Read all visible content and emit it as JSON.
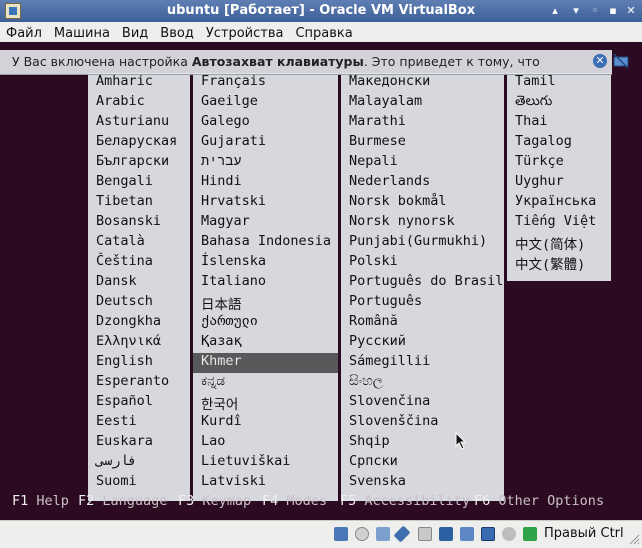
{
  "window": {
    "title": "ubuntu [Работает] - Oracle VM VirtualBox",
    "buttons": [
      "▴",
      "▾",
      "◦",
      "▪",
      "✕"
    ]
  },
  "menu": [
    "Файл",
    "Машина",
    "Вид",
    "Ввод",
    "Устройства",
    "Справка"
  ],
  "notification": {
    "prefix": "У Вас включена настройка ",
    "bold": "Автозахват клавиатуры",
    "suffix": ". Это приведет к тому, что"
  },
  "languages": {
    "col1": [
      "Amharic",
      "Arabic",
      "Asturianu",
      "Беларуская",
      "Български",
      "Bengali",
      "Tibetan",
      "Bosanski",
      "Català",
      "Čeština",
      "Dansk",
      "Deutsch",
      "Dzongkha",
      "Ελληνικά",
      "English",
      "Esperanto",
      "Español",
      "Eesti",
      "Euskara",
      "فارسی",
      "Suomi"
    ],
    "col2": [
      "Français",
      "Gaeilge",
      "Galego",
      "Gujarati",
      "עברית",
      "Hindi",
      "Hrvatski",
      "Magyar",
      "Bahasa Indonesia",
      "Íslenska",
      "Italiano",
      "日本語",
      "ქართული",
      "Қазақ",
      "Khmer",
      "ಕನ್ನಡ",
      "한국어",
      "Kurdî",
      "Lao",
      "Lietuviškai",
      "Latviski"
    ],
    "col3": [
      "Македонски",
      "Malayalam",
      "Marathi",
      "Burmese",
      "Nepali",
      "Nederlands",
      "Norsk bokmål",
      "Norsk nynorsk",
      "Punjabi(Gurmukhi)",
      "Polski",
      "Português do Brasil",
      "Português",
      "Română",
      "Русский",
      "Sámegillii",
      "සිංහල",
      "Slovenčina",
      "Slovenščina",
      "Shqip",
      "Српски",
      "Svenska"
    ],
    "col4": [
      "Tamil",
      "తెలుగు",
      "Thai",
      "Tagalog",
      "Türkçe",
      "Uyghur",
      "Українська",
      "Tiếng Việt",
      "中文(简体)",
      "中文(繁體)"
    ],
    "selected": "Khmer"
  },
  "function_keys": [
    {
      "key": "F1",
      "label": "Help"
    },
    {
      "key": "F2",
      "label": "Language"
    },
    {
      "key": "F3",
      "label": "Keymap"
    },
    {
      "key": "F4",
      "label": "Modes"
    },
    {
      "key": "F5",
      "label": "Accessibility"
    },
    {
      "key": "F6",
      "label": "Other Options"
    }
  ],
  "status": {
    "host_key": "Правый Ctrl",
    "icons": [
      "hard-disk-icon",
      "optical-drive-icon",
      "usb-icon",
      "audio-icon",
      "shared-folder-icon",
      "display-icon",
      "network-icon",
      "video-capture-icon",
      "mouse-integration-icon",
      "keyboard-capture-icon"
    ]
  },
  "colors": {
    "titlebar": "#4a6ba5",
    "screen_bg": "#2c0b22",
    "menu_column_bg": "#d6d8dd",
    "selection": "#58595b"
  }
}
